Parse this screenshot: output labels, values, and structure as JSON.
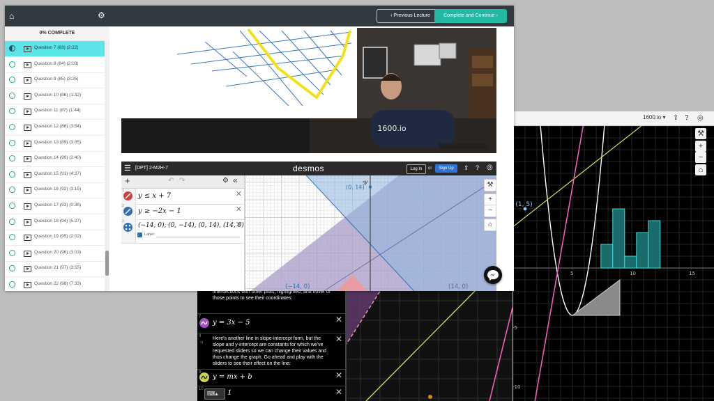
{
  "main": {
    "progress_label": "0% COMPLETE",
    "prev_label": "Previous Lecture",
    "next_label": "Complete and Continue",
    "lessons": [
      {
        "label": "Question 7 (83) (2:22)"
      },
      {
        "label": "Question 8 (84) (2:03)"
      },
      {
        "label": "Question 9 (85) (3:25)"
      },
      {
        "label": "Question 10 (86) (1:32)"
      },
      {
        "label": "Question 11 (87) (1:44)"
      },
      {
        "label": "Question 12 (88) (3:54)"
      },
      {
        "label": "Question 13 (89) (3:05)"
      },
      {
        "label": "Question 14 (90) (2:40)"
      },
      {
        "label": "Question 15 (91) (4:37)"
      },
      {
        "label": "Question 16 (92) (3:15)"
      },
      {
        "label": "Question 17 (93) (0:36)"
      },
      {
        "label": "Question 18 (94) (5:27)"
      },
      {
        "label": "Question 19 (95) (2:02)"
      },
      {
        "label": "Question 20 (96) (3:03)"
      },
      {
        "label": "Question 21 (97) (3:55)"
      },
      {
        "label": "Question 22 (98) (7:33)"
      }
    ],
    "video": {
      "shirt_text": "1600.io"
    },
    "desmos": {
      "title": "[DPT] 2-M2H-7",
      "logo": "desmos",
      "login": "Log In",
      "or": "or",
      "signup": "Sign Up",
      "eq1": "y ≤ x + 7",
      "eq2": "y ≥ −2x − 1",
      "eq3": "(−14, 0), (0, −14), (0, 14), (14, 0)",
      "label_checkbox": "Label:",
      "axis_y": "y",
      "pt_top": "(0, 14)",
      "pt_left": "(−14, 0)",
      "pt_right": "(14, 0)",
      "ticks": [
        "15",
        "10",
        "5"
      ]
    }
  },
  "right": {
    "account": "1600.io ▾",
    "point_label": "(1, 5)",
    "x_ticks": [
      "5",
      "10",
      "15"
    ],
    "y_ticks": [
      "-5",
      "-10"
    ]
  },
  "back": {
    "note1": "intersections with other plots, highlighted, and hover of those points to see their coordinates:",
    "eq1": "y = 3x − 5",
    "note2": "Here's another line in slope-intercept form, but the slope and y-intercept are constants for which we've requested sliders so we can change their values and thus change the graph. Go ahead and play with the sliders to see their effect on the line:",
    "eq2": "y = mx + b",
    "eq3": "b = 1",
    "idx": [
      "7",
      "8",
      "9",
      "10"
    ]
  },
  "colors": {
    "topbar": "#313a3f",
    "accent": "#22b8a1",
    "active_lesson": "#5be5e8",
    "region_blue": "#8fb6df",
    "region_purple": "#a89cc8",
    "region_red": "#ec9b9b"
  }
}
